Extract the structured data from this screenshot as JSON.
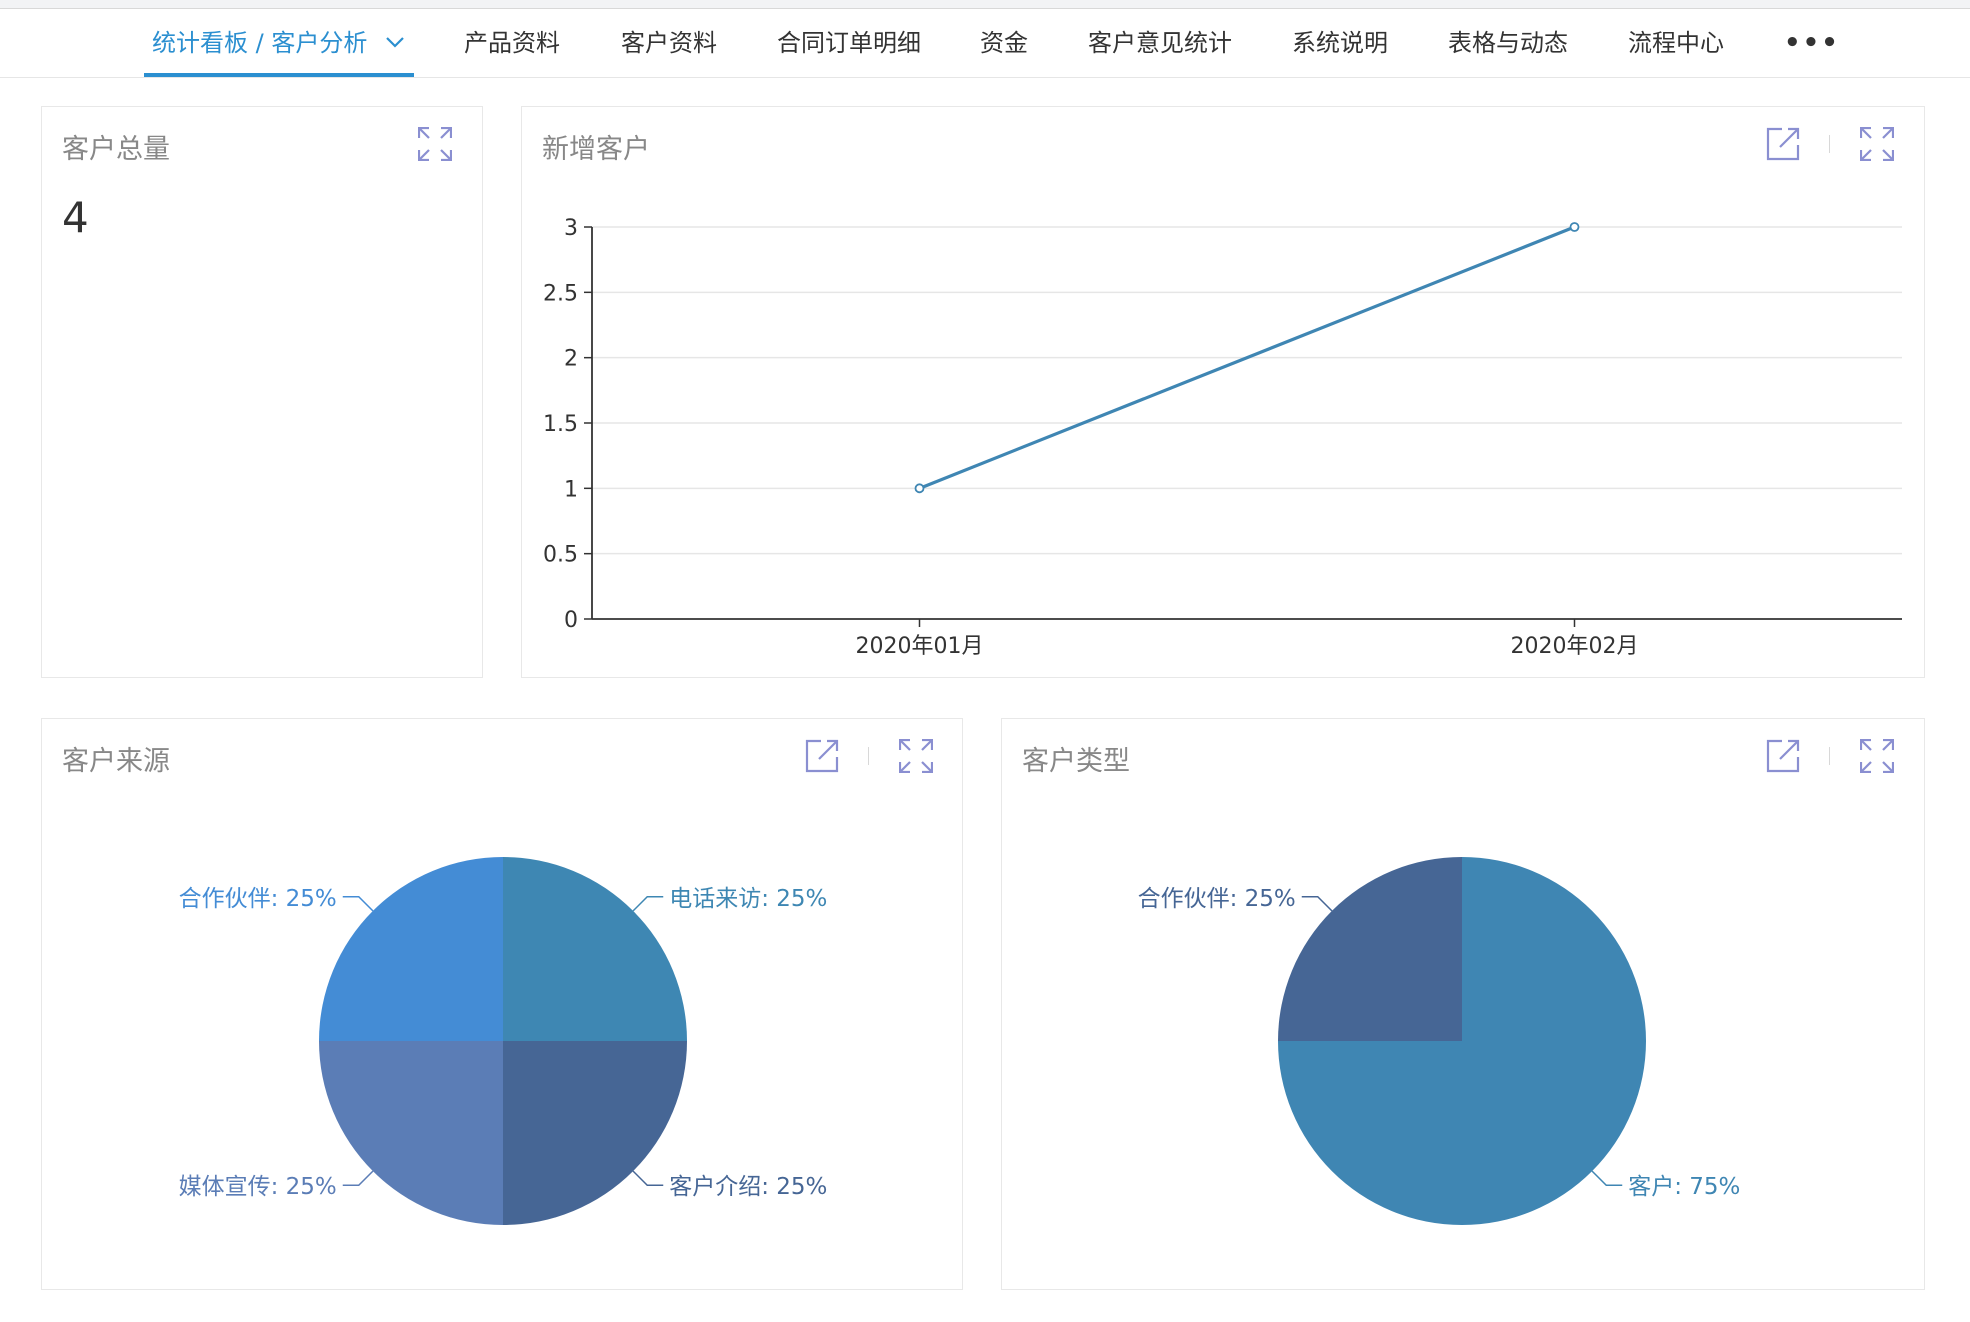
{
  "nav": {
    "active_label": "统计看板 / 客户分析",
    "items": [
      "产品资料",
      "客户资料",
      "合同订单明细",
      "资金",
      "客户意见统计",
      "系统说明",
      "表格与动态",
      "流程中心"
    ],
    "more_label": "•••"
  },
  "total_customers": {
    "title": "客户总量",
    "value": "4"
  },
  "new_customers": {
    "title": "新增客户"
  },
  "customer_source": {
    "title": "客户来源"
  },
  "customer_type": {
    "title": "客户类型"
  },
  "colors": {
    "accent": "#2b8fd0",
    "line": "#3f86b3",
    "icon": "#8a8fd1"
  },
  "chart_data": [
    {
      "type": "line",
      "title": "新增客户",
      "categories": [
        "2020年01月",
        "2020年02月"
      ],
      "values": [
        1,
        3
      ],
      "ylim": [
        0,
        3
      ],
      "yticks": [
        "0",
        "0.5",
        "1",
        "1.5",
        "2",
        "2.5",
        "3"
      ],
      "grid": true
    },
    {
      "type": "pie",
      "title": "客户来源",
      "slices": [
        {
          "label": "电话来访",
          "value": 25,
          "text": "电话来访: 25%",
          "color": "#3e87b3",
          "text_color": "#3e87b3"
        },
        {
          "label": "客户介绍",
          "value": 25,
          "text": "客户介绍: 25%",
          "color": "#466695",
          "text_color": "#466695"
        },
        {
          "label": "媒体宣传",
          "value": 25,
          "text": "媒体宣传: 25%",
          "color": "#5b7db6",
          "text_color": "#5b7db6"
        },
        {
          "label": "合作伙伴",
          "value": 25,
          "text": "合作伙伴: 25%",
          "color": "#448cd5",
          "text_color": "#448cd5"
        }
      ]
    },
    {
      "type": "pie",
      "title": "客户类型",
      "slices": [
        {
          "label": "客户",
          "value": 75,
          "text": "客户: 75%",
          "color": "#3f86b3",
          "text_color": "#3f86b3"
        },
        {
          "label": "合作伙伴",
          "value": 25,
          "text": "合作伙伴: 25%",
          "color": "#466695",
          "text_color": "#466695"
        }
      ]
    }
  ]
}
